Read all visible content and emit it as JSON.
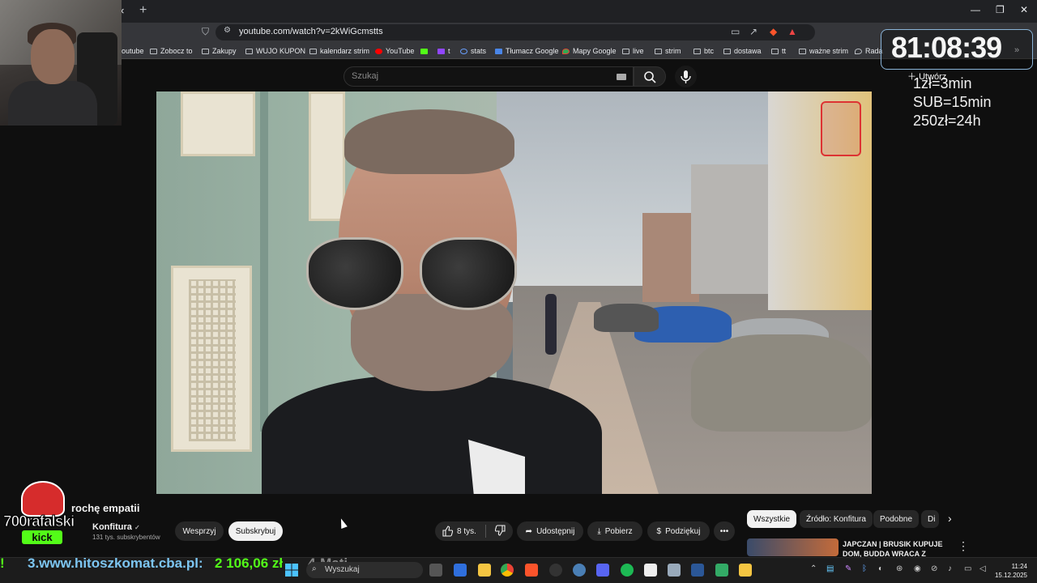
{
  "browser": {
    "url": "youtube.com/watch?v=2kWiGcmstts",
    "new_tab": "+",
    "close_tab": "×",
    "window_controls": [
      "—",
      "❐",
      "✕"
    ]
  },
  "bookmarks": [
    {
      "label": "outube",
      "icon": "folder-icon"
    },
    {
      "label": "Zobocz to",
      "icon": "folder-icon"
    },
    {
      "label": "Zakupy",
      "icon": "folder-icon"
    },
    {
      "label": "WUJO KUPON",
      "icon": "folder-icon"
    },
    {
      "label": "kalendarz strim",
      "icon": "folder-icon"
    },
    {
      "label": "YouTube",
      "icon": "youtube-icon"
    },
    {
      "label": "",
      "icon": "kick-icon"
    },
    {
      "label": "t",
      "icon": "twitch-icon"
    },
    {
      "label": "stats",
      "icon": "stats-icon"
    },
    {
      "label": "Tłumacz Google",
      "icon": "translate-icon"
    },
    {
      "label": "Mapy Google",
      "icon": "maps-icon"
    },
    {
      "label": "live",
      "icon": "folder-icon"
    },
    {
      "label": "strim",
      "icon": "folder-icon"
    },
    {
      "label": "btc",
      "icon": "folder-icon"
    },
    {
      "label": "dostawa",
      "icon": "folder-icon"
    },
    {
      "label": "tt",
      "icon": "folder-icon"
    },
    {
      "label": "ważne strim",
      "icon": "folder-icon"
    },
    {
      "label": "Rada",
      "icon": "drop-icon"
    }
  ],
  "youtube": {
    "search_placeholder": "Szukaj",
    "create_label": "Utwórz",
    "video_title": "rochę empatii",
    "channel": "Konfitura",
    "verified_icon": "✓",
    "subscribers": "131 tys. subskrybentów",
    "support_btn": "Wesprzyj",
    "subscribe_btn": "Subskrybuj",
    "likes": "8 tys.",
    "share_btn": "Udostępnij",
    "download_btn": "Pobierz",
    "thanks_btn": "Podziękuj",
    "more_btn": "•••",
    "chips": [
      "Wszystkie",
      "Źródło: Konfitura",
      "Podobne",
      "Di"
    ],
    "rec_title_1": "JAPCZAN | BRUSIK KUPUJE",
    "rec_title_2": "DOM, BUDDA WRACA Z",
    "rec_menu": "⋮"
  },
  "overlay": {
    "timer": "81:08:39",
    "rates": [
      "1zł=3min",
      "SUB=15min",
      "250zł=24h"
    ],
    "logo_name": "700rafalski",
    "logo_platform": "kick",
    "ticker_pre": "3.www.hitoszkomat.cba.pl:",
    "ticker_amount": "2 106,06 zł",
    "ticker_post": "4-Mati"
  },
  "taskbar": {
    "search_placeholder": "Wyszukaj",
    "time": "11:24",
    "date": "15.12.2025"
  },
  "colors": {
    "youtube_bg": "#0f0f0f",
    "kick_green": "#53fc18",
    "pill_bg": "#272727",
    "ticker_green": "#53fc18"
  }
}
